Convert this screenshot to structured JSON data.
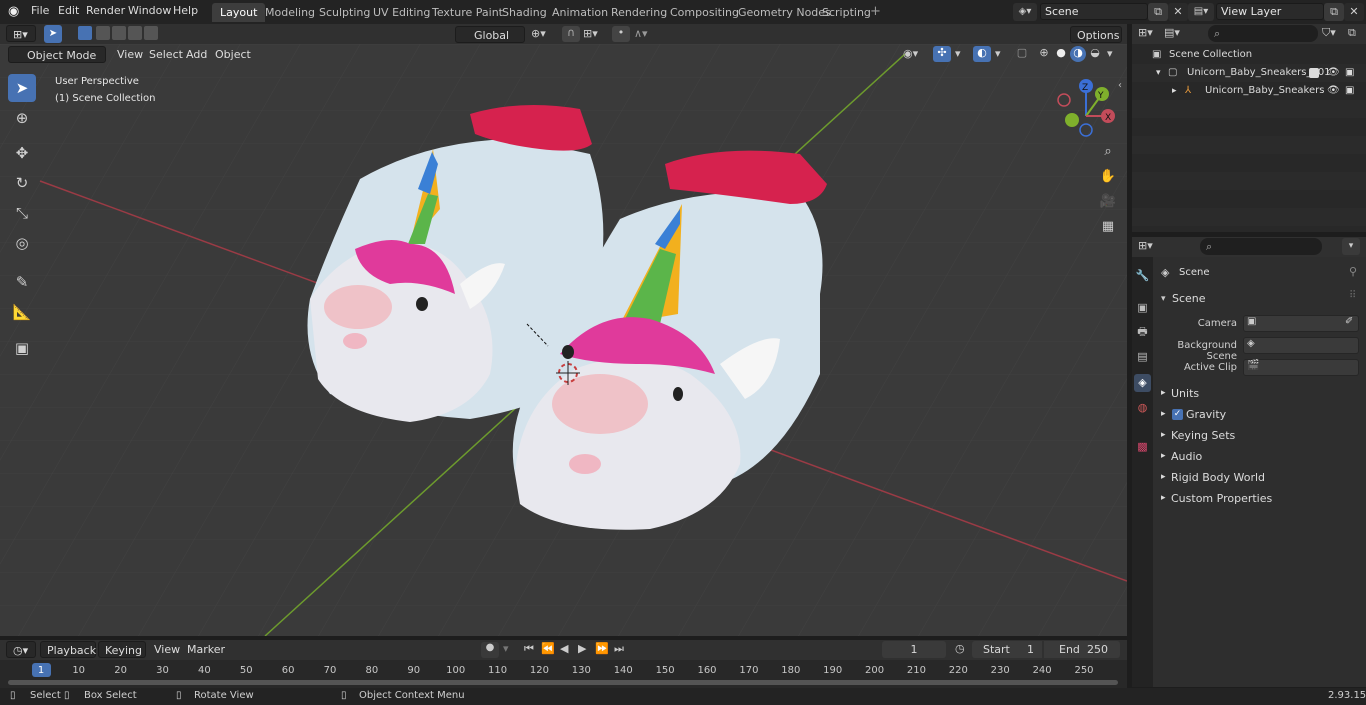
{
  "menu": [
    "File",
    "Edit",
    "Render",
    "Window",
    "Help"
  ],
  "workspaces": [
    {
      "label": "Layout",
      "active": true
    },
    {
      "label": "Modeling",
      "active": false
    },
    {
      "label": "Sculpting",
      "active": false
    },
    {
      "label": "UV Editing",
      "active": false
    },
    {
      "label": "Texture Paint",
      "active": false
    },
    {
      "label": "Shading",
      "active": false
    },
    {
      "label": "Animation",
      "active": false
    },
    {
      "label": "Rendering",
      "active": false
    },
    {
      "label": "Compositing",
      "active": false
    },
    {
      "label": "Geometry Nodes",
      "active": false
    },
    {
      "label": "Scripting",
      "active": false
    }
  ],
  "scene_field": "Scene",
  "view_layer_field": "View Layer",
  "viewport_header": {
    "mode": "Object Mode",
    "view": "View",
    "select": "Select",
    "add": "Add",
    "object": "Object",
    "orientation": "Global",
    "options": "Options"
  },
  "viewport_overlay": {
    "perspective": "User Perspective",
    "collection": "(1) Scene Collection"
  },
  "gizmo": {
    "z": "Z",
    "y": "Y",
    "x": "X"
  },
  "outliner": {
    "root": "Scene Collection",
    "items": [
      {
        "label": "Unicorn_Baby_Sneakers_001"
      },
      {
        "label": "Unicorn_Baby_Sneakers"
      }
    ]
  },
  "properties": {
    "context_title": "Scene",
    "panel_title": "Scene",
    "fields": [
      {
        "label": "Camera",
        "value": ""
      },
      {
        "label": "Background Scene",
        "value": ""
      },
      {
        "label": "Active Clip",
        "value": ""
      }
    ],
    "panels": [
      "Units",
      "Gravity",
      "Keying Sets",
      "Audio",
      "Rigid Body World",
      "Custom Properties"
    ]
  },
  "timeline": {
    "playback": "Playback",
    "keying": "Keying",
    "view": "View",
    "marker": "Marker",
    "current_frame": "1",
    "start_label": "Start",
    "start_value": "1",
    "end_label": "End",
    "end_value": "250",
    "ruler": [
      "1",
      "10",
      "20",
      "30",
      "40",
      "50",
      "60",
      "70",
      "80",
      "90",
      "100",
      "110",
      "120",
      "130",
      "140",
      "150",
      "160",
      "170",
      "180",
      "190",
      "200",
      "210",
      "220",
      "230",
      "240",
      "250"
    ]
  },
  "statusbar": {
    "select": "Select",
    "box_select": "Box Select",
    "rotate_view": "Rotate View",
    "context_menu": "Object Context Menu",
    "version": "2.93.15"
  }
}
